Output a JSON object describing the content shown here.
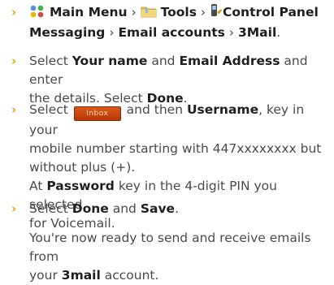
{
  "steps": [
    {
      "parts": {
        "main_menu": "Main Menu",
        "tools": "Tools",
        "control_panel": "Control Panel",
        "messaging": "Messaging",
        "email_accounts": "Email accounts",
        "threemail": "3Mail"
      },
      "separator": "›",
      "end": "."
    },
    {
      "text_a": "Select ",
      "bold_a": "Your name",
      "text_b": " and ",
      "bold_b": "Email Address",
      "text_c": " and enter",
      "text_d": "the details. Select ",
      "bold_c": "Done",
      "text_e": "."
    },
    {
      "text_a": "Select ",
      "button_label": "Inbox",
      "text_b": " and then ",
      "bold_a": "Username",
      "text_c": ", key in your",
      "line2": "mobile number starting with 447xxxxxxxx but",
      "line3": "without plus (+).",
      "line4_a": "At ",
      "bold_b": "Password",
      "line4_b": " key in the 4-digit PIN you selected",
      "line5": "for Voicemail."
    },
    {
      "text_a": "Select ",
      "bold_a": "Done",
      "text_b": " and ",
      "bold_b": "Save",
      "text_c": "."
    }
  ],
  "closing": {
    "line1": "You're now ready to send and receive emails from",
    "line2_a": "your ",
    "bold": "3mail",
    "line2_b": " account."
  },
  "icons": {
    "menu_icon": "four-dots-menu-icon",
    "tools_icon": "folder-icon",
    "control_panel_icon": "phone-wrench-icon"
  },
  "colors": {
    "bullet": "#e8a100",
    "text": "#4a4a4a",
    "bold": "#1f1f1f"
  }
}
